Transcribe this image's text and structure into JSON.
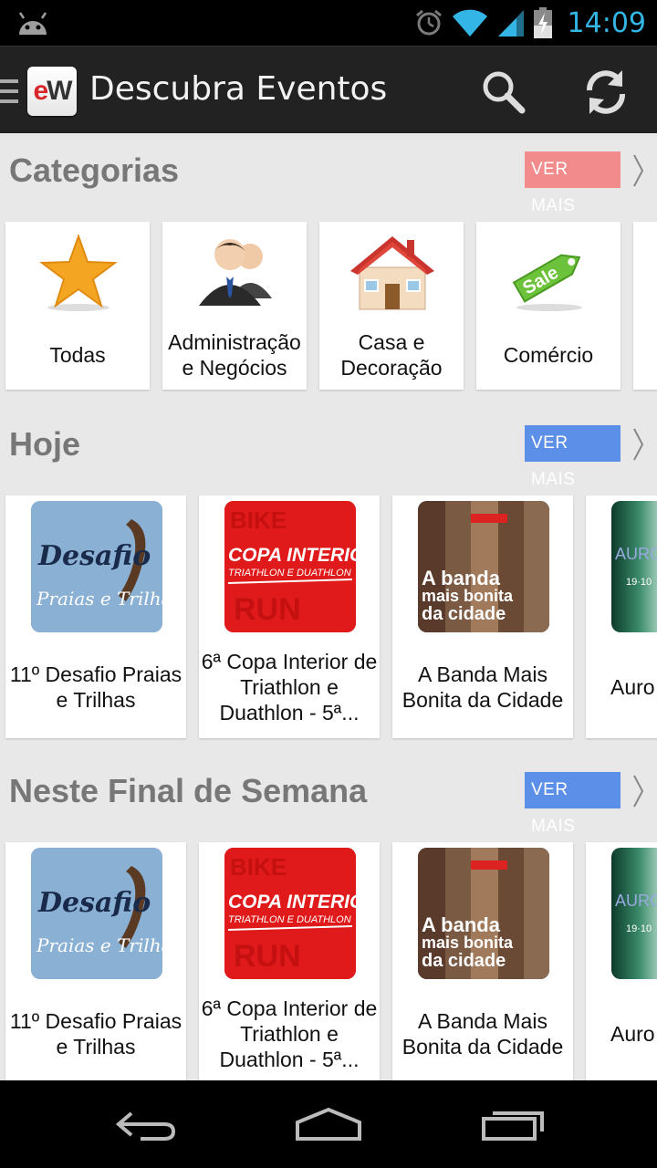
{
  "status": {
    "time": "14:09"
  },
  "app": {
    "title": "Descubra Eventos"
  },
  "sections": {
    "categorias": {
      "title": "Categorias",
      "ver_mais": "VER MAIS",
      "items": [
        {
          "label": "Todas",
          "icon": "star-icon"
        },
        {
          "label": "Administração e Negócios",
          "icon": "business-people-icon"
        },
        {
          "label": "Casa e Decoração",
          "icon": "house-icon"
        },
        {
          "label": "Comércio",
          "icon": "sale-tag-icon"
        }
      ]
    },
    "hoje": {
      "title": "Hoje",
      "ver_mais": "VER MAIS",
      "items": [
        {
          "label": "11º Desafio Praias e Trilhas",
          "thumb_text_1": "Desafio",
          "thumb_text_2": "Praias e Trilhas"
        },
        {
          "label": "6ª Copa Interior de Triathlon e Duathlon - 5ª...",
          "thumb_text_1": "COPA INTERIOR",
          "thumb_text_2": "TRIATHLON E DUATHLON"
        },
        {
          "label": "A Banda Mais Bonita da Cidade",
          "thumb_text_1": "A banda",
          "thumb_text_2": "mais bonita",
          "thumb_text_3": "da cidade"
        },
        {
          "label": "Auro",
          "thumb_text_1": "AURO",
          "thumb_text_2": "19·10"
        }
      ]
    },
    "fim_semana": {
      "title": "Neste Final de Semana",
      "ver_mais": "VER MAIS",
      "items": [
        {
          "label": "11º Desafio Praias e Trilhas",
          "thumb_text_1": "Desafio",
          "thumb_text_2": "Praias e Trilhas"
        },
        {
          "label": "6ª Copa Interior de Triathlon e Duathlon - 5ª...",
          "thumb_text_1": "COPA INTERIOR",
          "thumb_text_2": "TRIATHLON E DUATHLON"
        },
        {
          "label": "A Banda Mais Bonita da Cidade",
          "thumb_text_1": "A banda",
          "thumb_text_2": "mais bonita",
          "thumb_text_3": "da cidade"
        },
        {
          "label": "Auro",
          "thumb_text_1": "AURO",
          "thumb_text_2": "19·10"
        }
      ]
    }
  },
  "colors": {
    "accent": "#33b5e5",
    "ver_mais_red": "#f28b8b",
    "ver_mais_blue": "#5b8fe8",
    "logo_red": "#d9262b"
  }
}
